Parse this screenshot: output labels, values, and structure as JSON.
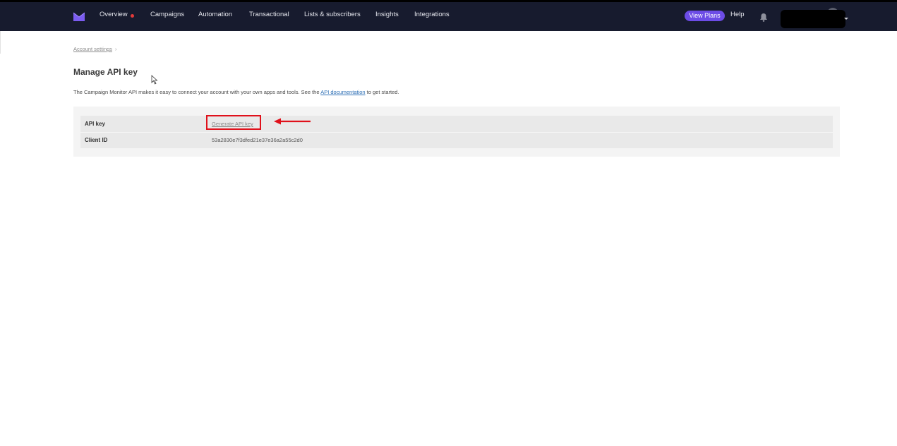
{
  "nav": {
    "items": [
      {
        "label": "Overview"
      },
      {
        "label": "Campaigns"
      },
      {
        "label": "Automation"
      },
      {
        "label": "Transactional"
      },
      {
        "label": "Lists & subscribers"
      },
      {
        "label": "Insights"
      },
      {
        "label": "Integrations"
      }
    ],
    "view_plans": "View Plans",
    "help": "Help"
  },
  "colors": {
    "navbar_bg": "#171b2e",
    "accent": "#6c4ce6",
    "notification_dot": "#e23a3a",
    "highlight": "#e0111b",
    "link": "#2d6fb5"
  },
  "breadcrumb": {
    "link": "Account settings",
    "separator": "›"
  },
  "page": {
    "title": "Manage API key",
    "intro_before": "The Campaign Monitor API makes it easy to connect your account with your own apps and tools. See the ",
    "intro_link": "API documentation",
    "intro_after": " to get started."
  },
  "api_table": {
    "rows": [
      {
        "label": "API key",
        "value": "Generate API key"
      },
      {
        "label": "Client ID",
        "value": "53a2830e7f3dfed21e37e36a2a55c2d0"
      }
    ]
  },
  "icons": {
    "logo": "campaign-monitor-logo",
    "bell": "bell-icon",
    "cursor": "mouse-pointer-icon",
    "arrow": "red-arrow-annotation"
  }
}
